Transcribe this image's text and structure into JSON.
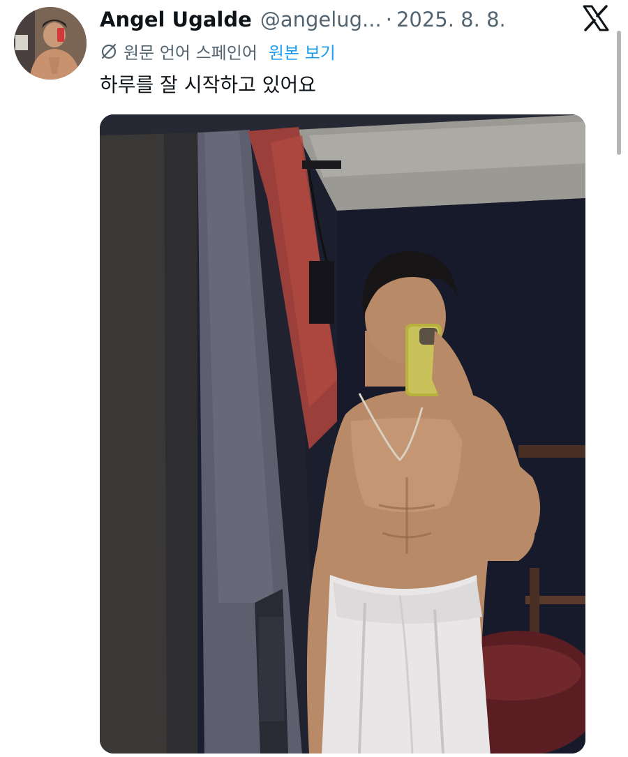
{
  "tweet": {
    "display_name": "Angel Ugalde",
    "handle": "@angelug...",
    "separator": "·",
    "date": "2025. 8. 8.",
    "translation": {
      "icon": "translate-icon",
      "label": "원문 언어 스페인어",
      "show_original": "원본 보기"
    },
    "text": "하루를 잘 시작하고 있어요"
  },
  "icons": {
    "platform_logo": "x-logo-icon"
  },
  "colors": {
    "name_text": "#0f1419",
    "secondary_text": "#536471",
    "link": "#1d9bf0",
    "background": "#ffffff"
  }
}
